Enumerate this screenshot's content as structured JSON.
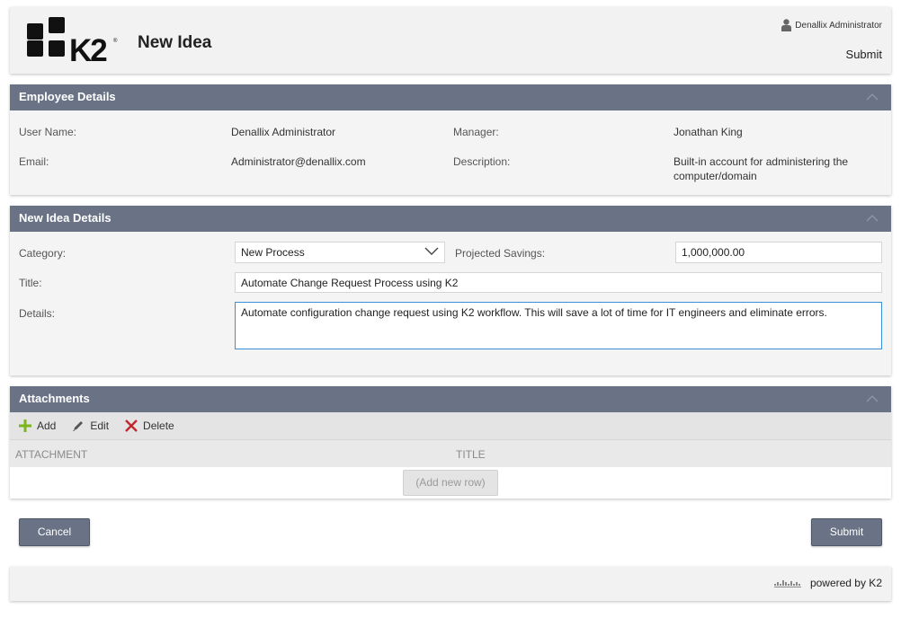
{
  "header": {
    "title": "New Idea",
    "user_name": "Denallix Administrator",
    "submit_label": "Submit",
    "logo_text": "K2"
  },
  "employee": {
    "section_title": "Employee Details",
    "user_name_label": "User Name:",
    "user_name_value": "Denallix Administrator",
    "manager_label": "Manager:",
    "manager_value": "Jonathan King",
    "email_label": "Email:",
    "email_value": "Administrator@denallix.com",
    "description_label": "Description:",
    "description_value_line1": "Built-in account for administering the",
    "description_value_line2": "computer/domain"
  },
  "idea": {
    "section_title": "New Idea Details",
    "category_label": "Category:",
    "category_value": "New Process",
    "savings_label": "Projected Savings:",
    "savings_value": "1,000,000.00",
    "title_label": "Title:",
    "title_value": "Automate Change Request Process using K2",
    "details_label": "Details:",
    "details_value": "Automate configuration change request using K2 workflow. This will save a lot of time for IT engineers and eliminate errors."
  },
  "attachments": {
    "section_title": "Attachments",
    "add_label": "Add",
    "edit_label": "Edit",
    "delete_label": "Delete",
    "columns": [
      "ATTACHMENT",
      "TITLE"
    ],
    "add_row_label": "(Add new row)"
  },
  "actions": {
    "cancel_label": "Cancel",
    "submit_label": "Submit"
  },
  "footer": {
    "powered_text": "powered by K2"
  },
  "colors": {
    "section_header": "#697385",
    "focus_border": "#3a8fd6",
    "add_icon": "#7ab51d",
    "delete_icon": "#c0272d"
  },
  "icons": [
    "user-icon",
    "collapse-icon",
    "chevron-down-icon",
    "add-icon",
    "edit-icon",
    "delete-icon",
    "k2-logo",
    "k2-footer-logo"
  ]
}
